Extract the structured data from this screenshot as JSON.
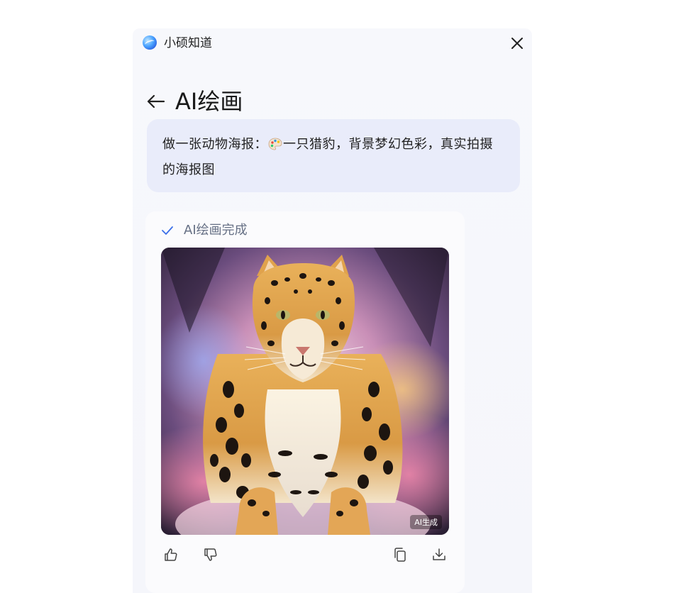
{
  "app": {
    "name": "小硕知道"
  },
  "page": {
    "title": "AI绘画"
  },
  "prompt": {
    "text_before": "做一张动物海报：",
    "text_after": "一只猎豹，背景梦幻色彩，真实拍摄的海报图"
  },
  "result": {
    "status_text": "AI绘画完成",
    "image_badge": "AI生成"
  },
  "icons": {
    "logo": "app-logo-icon",
    "close": "close-icon",
    "back": "arrow-left-icon",
    "check": "check-icon",
    "palette": "palette-emoji-icon",
    "like": "thumbs-up-icon",
    "dislike": "thumbs-down-icon",
    "copy": "copy-icon",
    "download": "download-icon"
  },
  "colors": {
    "accent": "#2b6cf6",
    "bubble": "#e9ecfa",
    "panel": "#f6f7fb"
  }
}
